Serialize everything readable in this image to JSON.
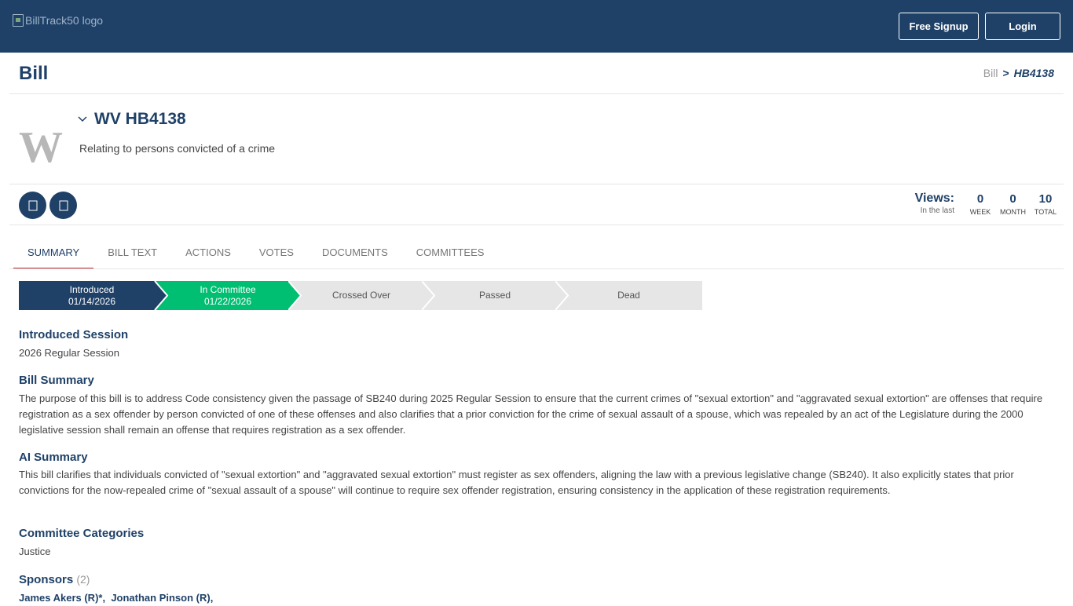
{
  "header": {
    "logo_alt": "BillTrack50 logo",
    "signup_label": "Free Signup",
    "login_label": "Login"
  },
  "page": {
    "title": "Bill",
    "breadcrumb": {
      "root": "Bill",
      "separator": ">",
      "current": "HB4138"
    }
  },
  "bill": {
    "state_letter": "W",
    "id": "WV HB4138",
    "description": "Relating to persons convicted of a crime"
  },
  "views": {
    "label": "Views:",
    "sublabel": "In the last",
    "week": {
      "value": "0",
      "label": "WEEK"
    },
    "month": {
      "value": "0",
      "label": "MONTH"
    },
    "total": {
      "value": "10",
      "label": "TOTAL"
    }
  },
  "tabs": [
    {
      "label": "SUMMARY"
    },
    {
      "label": "BILL TEXT"
    },
    {
      "label": "ACTIONS"
    },
    {
      "label": "VOTES"
    },
    {
      "label": "DOCUMENTS"
    },
    {
      "label": "COMMITTEES"
    }
  ],
  "progress": [
    {
      "label": "Introduced",
      "date": "01/14/2026",
      "state": "complete"
    },
    {
      "label": "In Committee",
      "date": "01/22/2026",
      "state": "current"
    },
    {
      "label": "Crossed Over",
      "date": "",
      "state": "pending"
    },
    {
      "label": "Passed",
      "date": "",
      "state": "pending"
    },
    {
      "label": "Dead",
      "date": "",
      "state": "pending"
    }
  ],
  "sections": {
    "introduced_session": {
      "heading": "Introduced Session",
      "text": "2026 Regular Session"
    },
    "bill_summary": {
      "heading": "Bill Summary",
      "text": "The purpose of this bill is to address Code consistency given the passage of SB240 during 2025 Regular Session to ensure that the current crimes of \"sexual extortion\" and \"aggravated sexual extortion\" are offenses that require registration as a sex offender by person convicted of one of these offenses and also clarifies that a prior conviction for the crime of sexual assault of a spouse, which was repealed by an act of the Legislature during the 2000 legislative session shall remain an offense that requires registration as a sex offender."
    },
    "ai_summary": {
      "heading": "AI Summary",
      "text": "This bill clarifies that individuals convicted of \"sexual extortion\" and \"aggravated sexual extortion\" must register as sex offenders, aligning the law with a previous legislative change (SB240). It also explicitly states that prior convictions for the now-repealed crime of \"sexual assault of a spouse\" will continue to require sex offender registration, ensuring consistency in the application of these registration requirements."
    },
    "committee_categories": {
      "heading": "Committee Categories",
      "text": "Justice"
    },
    "sponsors": {
      "heading": "Sponsors",
      "count": "(2)",
      "list": [
        "James Akers (R)*,",
        "Jonathan Pinson (R),"
      ]
    }
  },
  "colors": {
    "brand": "#1f4168",
    "current_step": "#00bf73",
    "pending_step": "#e6e6e6",
    "tab_underline": "#c1272d"
  }
}
